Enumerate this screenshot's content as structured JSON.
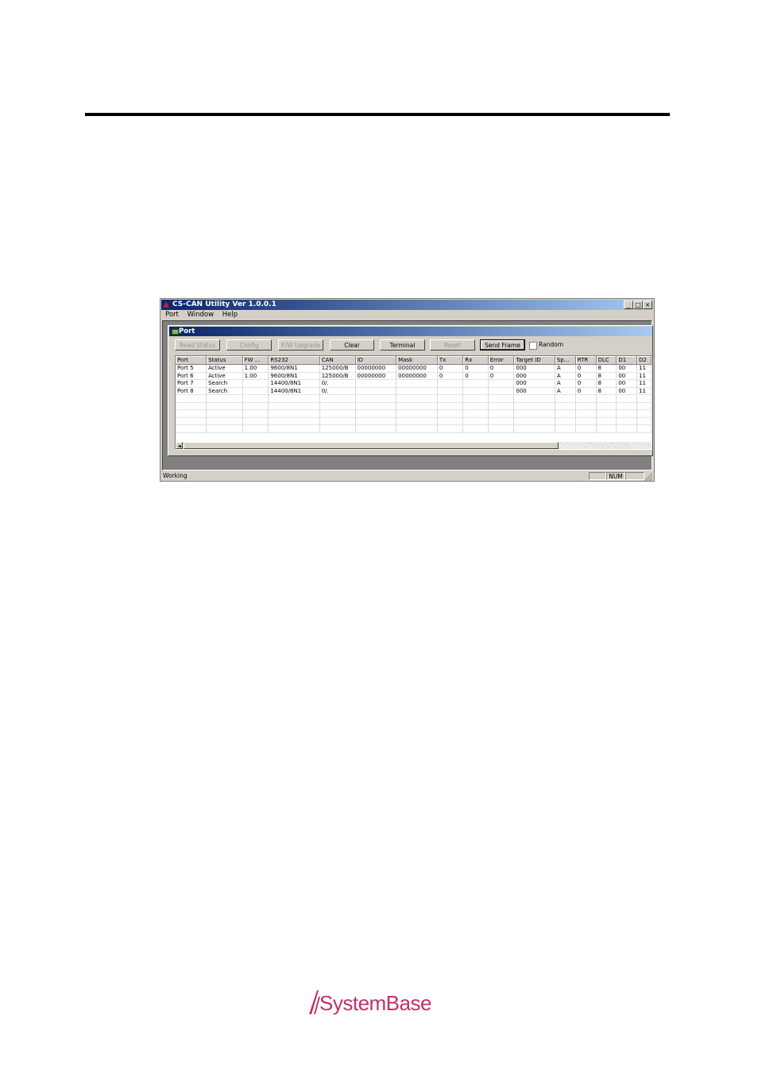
{
  "window": {
    "title": "CS-CAN Utility Ver 1.0.0.1",
    "controls": {
      "minimize": "_",
      "maximize": "□",
      "close": "×"
    }
  },
  "menu": [
    "Port",
    "Window",
    "Help"
  ],
  "child_window": {
    "title": "Port"
  },
  "toolbar": {
    "read_status": "Read Status",
    "config": "Config",
    "fw_upgrade": "F/W Upgrade",
    "clear": "Clear",
    "terminal": "Terminal",
    "reset": "Reset",
    "send_frame": "Send Frame",
    "random_label": "Random",
    "random_checked": false
  },
  "grid": {
    "columns": [
      "Port",
      "Status",
      "FW ...",
      "RS232",
      "CAN",
      "ID",
      "Mask",
      "Tx",
      "Rx",
      "Error",
      "Target ID",
      "Sp...",
      "RTR",
      "DLC",
      "D1",
      "D2"
    ],
    "rows": [
      [
        "Port 5",
        "Active",
        "1.00",
        "9600/8N1",
        "125000/B",
        "00000000",
        "00000000",
        "0",
        "0",
        "0",
        "000",
        "A",
        "0",
        "8",
        "00",
        "11"
      ],
      [
        "Port 6",
        "Active",
        "1.00",
        "9600/8N1",
        "125000/B",
        "00000000",
        "00000000",
        "0",
        "0",
        "0",
        "000",
        "A",
        "0",
        "8",
        "00",
        "11"
      ],
      [
        "Port 7",
        "Search",
        "",
        "14400/8N1",
        "0/.",
        "",
        "",
        "",
        "",
        "",
        "000",
        "A",
        "0",
        "8",
        "00",
        "11"
      ],
      [
        "Port 8",
        "Search",
        "",
        "14400/8N1",
        "0/.",
        "",
        "",
        "",
        "",
        "",
        "000",
        "A",
        "0",
        "8",
        "00",
        "11"
      ]
    ],
    "scroll_left_arrow": "◄"
  },
  "statusbar": {
    "text": "Working",
    "num": "NUM"
  },
  "logo": {
    "text": "SystemBase",
    "color": "#c0306a"
  }
}
